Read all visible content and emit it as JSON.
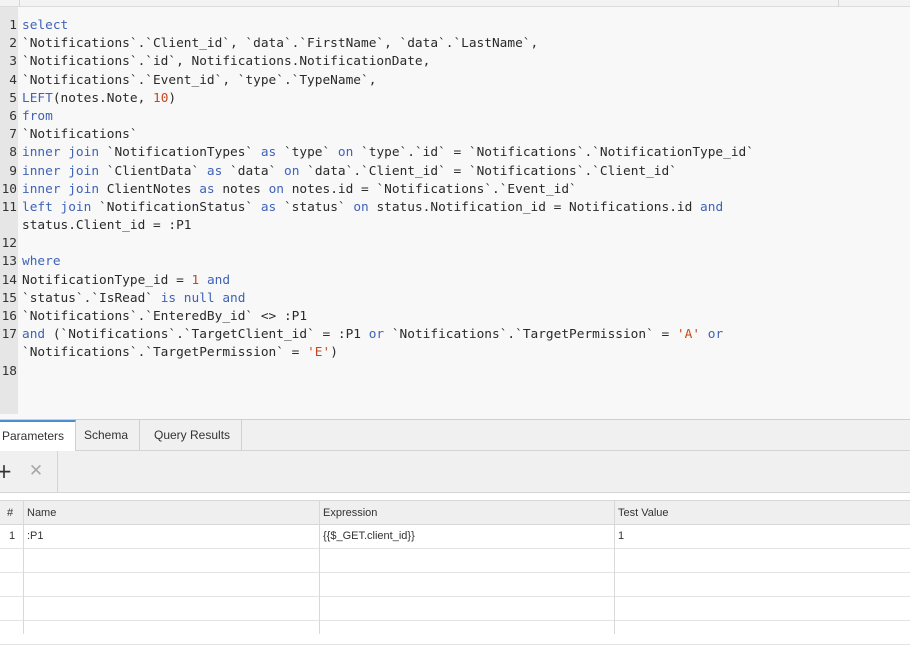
{
  "sql_lines": [
    {
      "n": "1",
      "t": [
        {
          "c": "k",
          "v": "select"
        }
      ]
    },
    {
      "n": "2",
      "t": [
        {
          "c": "",
          "v": "`Notifications`.`Client_id`, `data`.`FirstName`, `data`.`LastName`,"
        }
      ]
    },
    {
      "n": "3",
      "t": [
        {
          "c": "",
          "v": "`Notifications`.`id`, Notifications.NotificationDate,"
        }
      ]
    },
    {
      "n": "4",
      "t": [
        {
          "c": "",
          "v": "`Notifications`.`Event_id`, `type`.`TypeName`,"
        }
      ]
    },
    {
      "n": "5",
      "t": [
        {
          "c": "k",
          "v": "LEFT"
        },
        {
          "c": "",
          "v": "(notes.Note, "
        },
        {
          "c": "n",
          "v": "10"
        },
        {
          "c": "",
          "v": ")"
        }
      ]
    },
    {
      "n": "6",
      "t": [
        {
          "c": "k",
          "v": "from"
        }
      ]
    },
    {
      "n": "7",
      "t": [
        {
          "c": "",
          "v": "`Notifications`"
        }
      ]
    },
    {
      "n": "8",
      "t": [
        {
          "c": "k",
          "v": "inner join"
        },
        {
          "c": "",
          "v": " `NotificationTypes` "
        },
        {
          "c": "k",
          "v": "as"
        },
        {
          "c": "",
          "v": " `type` "
        },
        {
          "c": "k",
          "v": "on"
        },
        {
          "c": "",
          "v": " `type`.`id` = `Notifications`.`NotificationType_id`"
        }
      ]
    },
    {
      "n": "9",
      "t": [
        {
          "c": "k",
          "v": "inner join"
        },
        {
          "c": "",
          "v": " `ClientData` "
        },
        {
          "c": "k",
          "v": "as"
        },
        {
          "c": "",
          "v": " `data` "
        },
        {
          "c": "k",
          "v": "on"
        },
        {
          "c": "",
          "v": " `data`.`Client_id` = `Notifications`.`Client_id`"
        }
      ]
    },
    {
      "n": "10",
      "t": [
        {
          "c": "k",
          "v": "inner join"
        },
        {
          "c": "",
          "v": " ClientNotes "
        },
        {
          "c": "k",
          "v": "as"
        },
        {
          "c": "",
          "v": " notes "
        },
        {
          "c": "k",
          "v": "on"
        },
        {
          "c": "",
          "v": " notes.id = `Notifications`.`Event_id`"
        }
      ]
    },
    {
      "n": "11",
      "t": [
        {
          "c": "k",
          "v": "left join"
        },
        {
          "c": "",
          "v": " `NotificationStatus` "
        },
        {
          "c": "k",
          "v": "as"
        },
        {
          "c": "",
          "v": " `status` "
        },
        {
          "c": "k",
          "v": "on"
        },
        {
          "c": "",
          "v": " status.Notification_id = Notifications.id "
        },
        {
          "c": "k",
          "v": "and"
        }
      ]
    },
    {
      "n": "",
      "t": [
        {
          "c": "",
          "v": "status.Client_id = :P1"
        }
      ]
    },
    {
      "n": "12",
      "t": []
    },
    {
      "n": "13",
      "t": [
        {
          "c": "k",
          "v": "where"
        }
      ]
    },
    {
      "n": "14",
      "t": [
        {
          "c": "",
          "v": "NotificationType_id = "
        },
        {
          "c": "n",
          "v": "1"
        },
        {
          "c": "",
          "v": " "
        },
        {
          "c": "k",
          "v": "and"
        }
      ]
    },
    {
      "n": "15",
      "t": [
        {
          "c": "",
          "v": "`status`.`IsRead` "
        },
        {
          "c": "k",
          "v": "is null and"
        }
      ]
    },
    {
      "n": "16",
      "t": [
        {
          "c": "",
          "v": "`Notifications`.`EnteredBy_id` <> :P1"
        }
      ]
    },
    {
      "n": "17",
      "t": [
        {
          "c": "k",
          "v": "and"
        },
        {
          "c": "",
          "v": " (`Notifications`.`TargetClient_id` = :P1 "
        },
        {
          "c": "k",
          "v": "or"
        },
        {
          "c": "",
          "v": " `Notifications`.`TargetPermission` = "
        },
        {
          "c": "s",
          "v": "'A'"
        },
        {
          "c": "",
          "v": " "
        },
        {
          "c": "k",
          "v": "or"
        }
      ]
    },
    {
      "n": "",
      "t": [
        {
          "c": "",
          "v": "`Notifications`.`TargetPermission` = "
        },
        {
          "c": "s",
          "v": "'E'"
        },
        {
          "c": "",
          "v": ")"
        }
      ]
    },
    {
      "n": "18",
      "t": []
    }
  ],
  "tabs": [
    "Parameters",
    "Schema",
    "Query Results"
  ],
  "toolbar": {
    "add_glyph": "+",
    "remove_glyph": "✕"
  },
  "grid": {
    "headers": [
      "#",
      "Name",
      "Expression",
      "Test Value"
    ],
    "rows": [
      [
        "1",
        ":P1",
        "{{$_GET.client_id}}",
        "1"
      ]
    ]
  },
  "colors": {
    "keyword": "#3f63b8",
    "number": "#c8471a",
    "active_tab": "#4a8fd6"
  }
}
